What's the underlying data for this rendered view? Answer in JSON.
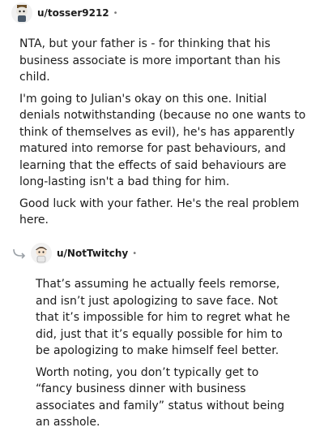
{
  "comments": [
    {
      "username": "u/tosser9212",
      "separator": "•",
      "avatar_icon": "snoo-avatar-icon",
      "paragraphs": [
        "NTA, but your father is - for thinking that his business associate is more important than his child.",
        "I'm going to Julian's okay on this one. Initial denials notwithstanding (because no one wants to think of themselves as evil), he's has apparently matured into remorse for past behaviours, and learning that the effects of said behaviours are long-lasting isn't a bad thing for him.",
        "Good luck with your father. He's the real problem here."
      ]
    },
    {
      "username": "u/NotTwitchy",
      "separator": "•",
      "avatar_icon": "snoo-avatar-icon",
      "reply_icon": "reply-arrow-icon",
      "paragraphs": [
        "That’s assuming he actually feels remorse, and isn’t just apologizing to save face. Not that it’s impossible for him to regret what he did, just that it’s equally possible for him to be apologizing to make himself feel better.",
        "Worth noting, you don’t typically get to “fancy business dinner with business associates and family” status without being an asshole."
      ]
    }
  ]
}
